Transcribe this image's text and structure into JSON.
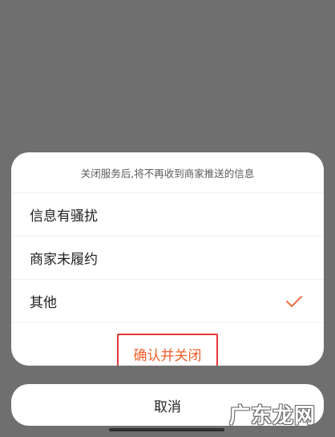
{
  "sheet": {
    "header": "关闭服务后,将不再收到商家推送的信息",
    "options": [
      {
        "label": "信息有骚扰",
        "selected": false
      },
      {
        "label": "商家未履约",
        "selected": false
      },
      {
        "label": "其他",
        "selected": true
      }
    ],
    "confirm_label": "确认并关闭"
  },
  "cancel_label": "取消",
  "watermark": "广东龙网",
  "colors": {
    "accent": "#ef5f2c",
    "highlight_box": "#e53935",
    "overlay": "#6f6f6f",
    "sheet_bg": "#ffffff",
    "text": "#222222"
  },
  "icons": {
    "selected": "check-icon"
  }
}
